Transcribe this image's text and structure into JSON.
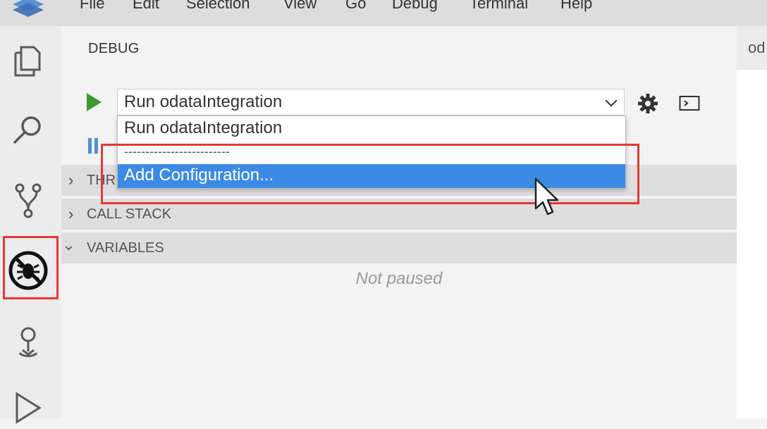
{
  "menubar": {
    "items": [
      "File",
      "Edit",
      "Selection",
      "View",
      "Go",
      "Debug",
      "Terminal",
      "Help"
    ]
  },
  "activitybar": {
    "icons": [
      "explorer-icon",
      "search-icon",
      "source-control-icon",
      "debug-icon",
      "remote-icon",
      "run-icon"
    ]
  },
  "sidebar": {
    "title": "DEBUG",
    "config_select": {
      "value": "Run odataIntegration"
    },
    "sections": {
      "threads": "THR",
      "call_stack": "CALL STACK",
      "variables": "VARIABLES"
    },
    "variables_empty": "Not paused"
  },
  "dropdown": {
    "options": [
      "Run odataIntegration",
      "-------------------------",
      "Add Configuration..."
    ],
    "selected_index": 2
  },
  "editor": {
    "tab_label": "od"
  },
  "colors": {
    "highlight_box": "#e53935",
    "selected_option": "#3c8ae6",
    "start_button": "#3c9a2f"
  }
}
